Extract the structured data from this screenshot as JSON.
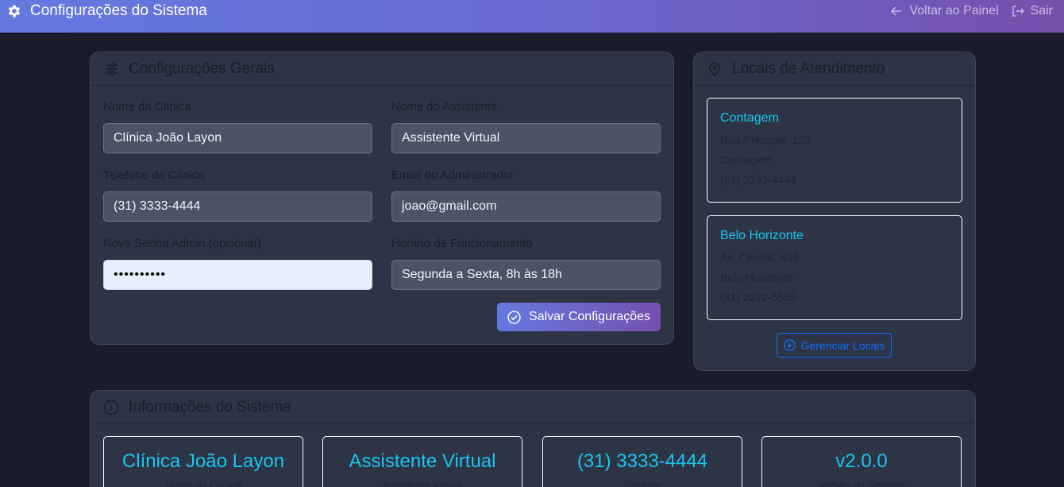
{
  "header": {
    "title": "Configurações do Sistema",
    "back_label": "Voltar ao Painel",
    "logout_label": "Sair"
  },
  "settings": {
    "title": "Configurações Gerais",
    "clinic_name_label": "Nome da Clínica",
    "clinic_name_value": "Clínica João Layon",
    "assistant_name_label": "Nome do Assistente",
    "assistant_name_value": "Assistente Virtual",
    "phone_label": "Telefone da Clínica",
    "phone_value": "(31) 3333-4444",
    "email_label": "Email do Administrador",
    "email_value": "joao@gmail.com",
    "password_label": "Nova Senha Admin (opcional)",
    "password_value": "••••••••••",
    "hours_label": "Horário de Funcionamento",
    "hours_value": "Segunda a Sexta, 8h às 18h",
    "save_label": "Salvar Configurações"
  },
  "locations": {
    "title": "Locais de Atendimento",
    "items": [
      {
        "name": "Contagem",
        "address": "Rua Principal, 123",
        "city": "Contagem",
        "phone": "(31) 3333-4444"
      },
      {
        "name": "Belo Horizonte",
        "address": "Av. Central, 456",
        "city": "Belo Horizonte",
        "phone": "(31) 2222-5555"
      }
    ],
    "manage_label": "Gerenciar Locais"
  },
  "system_info": {
    "title": "Informações do Sistema",
    "stats": [
      {
        "value": "Clínica João Layon",
        "caption": "Nome da Clínica"
      },
      {
        "value": "Assistente Virtual",
        "caption": "Assistente Virtual"
      },
      {
        "value": "(31) 3333-4444",
        "caption": "Telefone"
      },
      {
        "value": "v2.0.0",
        "caption": "Versão do Sistema"
      }
    ]
  },
  "colors": {
    "accent": "#19c6ef",
    "primary_link": "#0d6efd",
    "header_gradient_start": "#6479e0",
    "header_gradient_end": "#7650ad"
  }
}
